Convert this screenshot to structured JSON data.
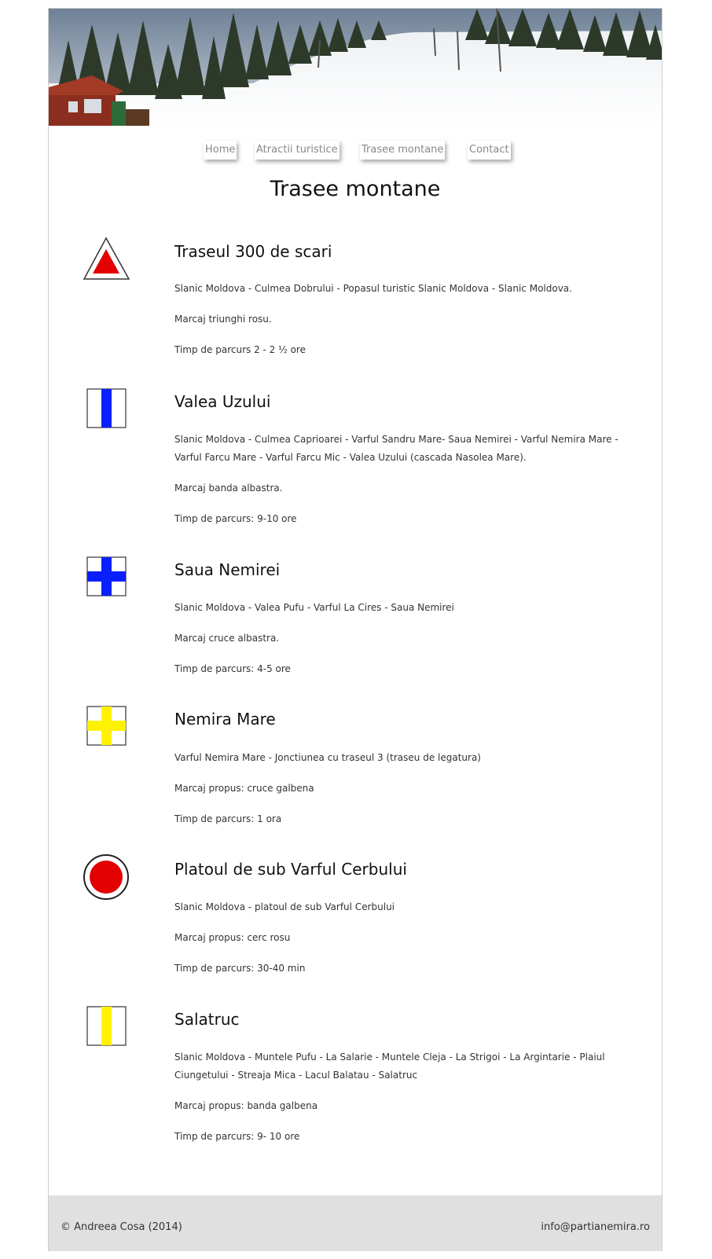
{
  "nav": {
    "items": [
      "Home",
      "Atractii turistice",
      "Trasee montane",
      "Contact"
    ]
  },
  "page_title": "Trasee montane",
  "trails": [
    {
      "title": "Traseul 300 de scari",
      "route": "Slanic Moldova - Culmea Dobrului - Popasul turistic Slanic Moldova - Slanic Moldova.",
      "marking": "Marcaj triunghi rosu.",
      "duration": "Timp de parcurs 2 - 2 ½ ore",
      "icon": "red-triangle-marker-icon"
    },
    {
      "title": "Valea Uzului",
      "route": "Slanic Moldova - Culmea Caprioarei - Varful Sandru Mare- Saua Nemirei - Varful Nemira Mare - Varful Farcu Mare - Varful Farcu Mic - Valea Uzului (cascada Nasolea Mare).",
      "marking": "Marcaj banda albastra.",
      "duration": "Timp de parcurs: 9-10 ore",
      "icon": "blue-stripe-marker-icon"
    },
    {
      "title": "Saua Nemirei",
      "route": "Slanic Moldova - Valea Pufu - Varful La Cires - Saua Nemirei",
      "marking": "Marcaj cruce albastra.",
      "duration": "Timp de parcurs: 4-5 ore",
      "icon": "blue-cross-marker-icon"
    },
    {
      "title": "Nemira Mare",
      "route": "Varful Nemira Mare - Jonctiunea cu traseul 3 (traseu de legatura)",
      "marking": "Marcaj propus: cruce galbena",
      "duration": "Timp de parcurs: 1 ora",
      "icon": "yellow-cross-marker-icon"
    },
    {
      "title": "Platoul de sub Varful Cerbului",
      "route": "Slanic Moldova - platoul de sub Varful Cerbului",
      "marking": "Marcaj propus: cerc rosu",
      "duration": "Timp de parcurs: 30-40 min",
      "icon": "red-circle-marker-icon"
    },
    {
      "title": "Salatruc",
      "route": "Slanic Moldova - Muntele Pufu - La Salarie - Muntele Cleja - La Strigoi - La Argintarie - Plaiul Ciungetului - Streaja Mica - Lacul Balatau - Salatruc",
      "marking": "Marcaj propus: banda galbena",
      "duration": "Timp de parcurs: 9- 10 ore",
      "icon": "yellow-stripe-marker-icon"
    }
  ],
  "footer": {
    "copyright": "© Andreea Cosa (2014)",
    "email": "info@partianemira.ro"
  },
  "colors": {
    "marker_red": "#e30000",
    "marker_blue": "#0a1fff",
    "marker_yellow": "#fff200",
    "footer_bg": "#e0e0e0"
  }
}
